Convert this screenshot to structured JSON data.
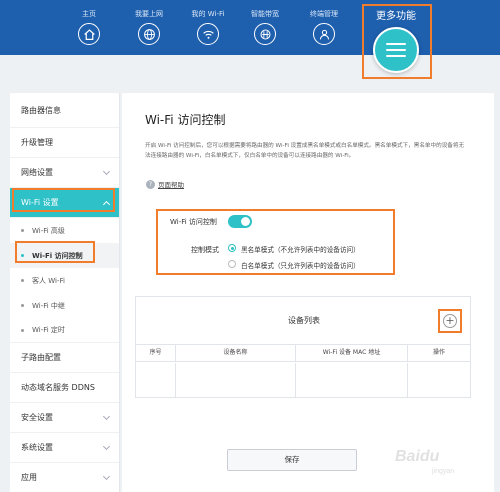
{
  "nav": {
    "items": [
      {
        "label": "主页",
        "icon": "home-icon"
      },
      {
        "label": "我要上网",
        "icon": "globe-icon"
      },
      {
        "label": "我的 Wi-Fi",
        "icon": "wifi-icon"
      },
      {
        "label": "智能带宽",
        "icon": "bandwidth-icon"
      },
      {
        "label": "终端管理",
        "icon": "user-icon"
      }
    ],
    "more_label": "更多功能",
    "more_icon": "menu-icon"
  },
  "sidebar": {
    "items": [
      {
        "label": "路由器信息"
      },
      {
        "label": "升级管理"
      },
      {
        "label": "网络设置"
      },
      {
        "label": "Wi-Fi 设置"
      },
      {
        "label": "子路由配置"
      },
      {
        "label": "动态域名服务 DDNS"
      },
      {
        "label": "安全设置"
      },
      {
        "label": "系统设置"
      },
      {
        "label": "应用"
      }
    ],
    "wifi_sub": [
      {
        "label": "Wi-Fi 高级"
      },
      {
        "label": "Wi-Fi 访问控制"
      },
      {
        "label": "客人 Wi-Fi"
      },
      {
        "label": "Wi-Fi 中继"
      },
      {
        "label": "Wi-Fi 定时"
      }
    ]
  },
  "main": {
    "title": "Wi-Fi 访问控制",
    "description": "开启 Wi-Fi 访问控制后，您可以根据需要将路由器的 Wi-Fi 设置成黑名单模式或白名单模式。黑名单模式下，黑名单中的设备将无法连接路由器的 Wi-Fi，白名单模式下，仅白名单中的设备可以连接路由器的 Wi-Fi。",
    "help_label": "页面帮助",
    "access_control_label": "Wi-Fi 访问控制",
    "access_control_enabled": true,
    "mode_label": "控制模式",
    "mode_options": [
      "黑名单模式（不允许列表中的设备访问）",
      "白名单模式（只允许列表中的设备访问）"
    ],
    "mode_selected": 0,
    "device_list": {
      "title": "设备列表",
      "columns": [
        "序号",
        "设备名称",
        "Wi-Fi 设备 MAC 地址",
        "操作"
      ],
      "rows": []
    },
    "save_label": "保存"
  },
  "watermark": {
    "text": "Baidu",
    "sub": "jingyan"
  },
  "colors": {
    "nav_bg": "#1e5fae",
    "accent": "#2ec1c7",
    "highlight": "#f07c2c"
  }
}
